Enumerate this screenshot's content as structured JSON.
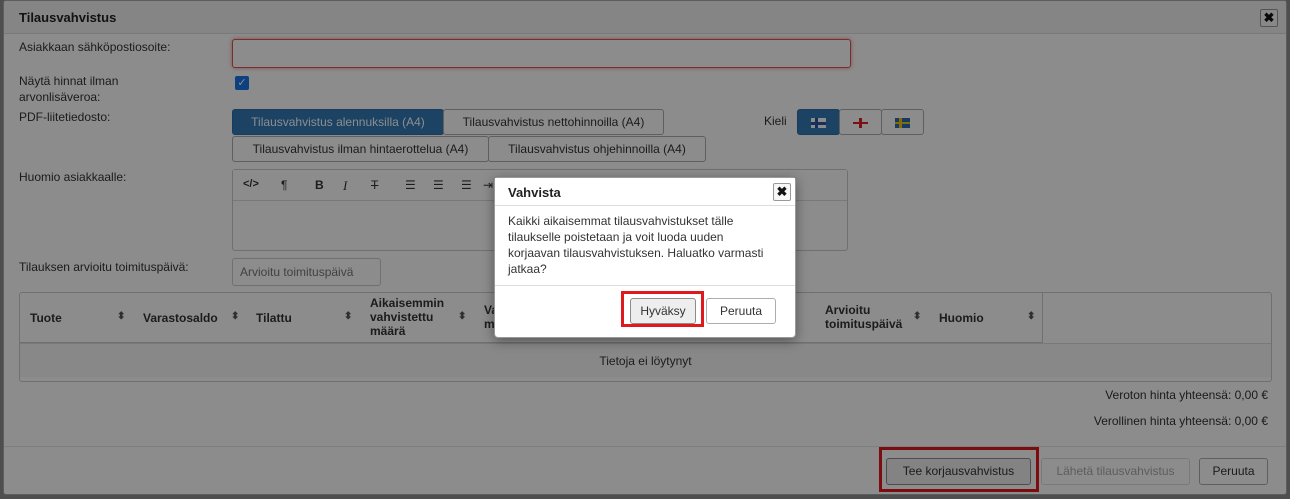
{
  "dialog": {
    "title": "Tilausvahvistus",
    "close_glyph": "✖"
  },
  "form": {
    "email_label": "Asiakkaan sähköpostiosoite:",
    "email_value": "",
    "show_prices_label_1": "Näytä hinnat ilman",
    "show_prices_label_2": "arvonlisäveroa:",
    "show_prices_checked": true,
    "pdf_label": "PDF-liitetiedosto:",
    "pdf_options": [
      "Tilausvahvistus alennuksilla (A4)",
      "Tilausvahvistus nettohinnoilla (A4)",
      "Tilausvahvistus ilman hintaerottelua (A4)",
      "Tilausvahvistus ohjehinnoilla (A4)"
    ],
    "pdf_selected": "Tilausvahvistus alennuksilla (A4)",
    "language_label": "Kieli",
    "languages": [
      "flag-fi-icon",
      "flag-en-icon",
      "flag-sv-icon"
    ],
    "language_selected": "flag-fi-icon",
    "note_label": "Huomio asiakkaalle:",
    "editor_tools": [
      "</>",
      "¶",
      "B",
      "I",
      "T"
    ],
    "delivery_label": "Tilauksen arvioitu toimituspäivä:",
    "delivery_placeholder": "Arvioitu toimituspäivä"
  },
  "table": {
    "columns": [
      {
        "l1": "Tuote",
        "l2": "",
        "l3": ""
      },
      {
        "l1": "Varastosaldo",
        "l2": "",
        "l3": ""
      },
      {
        "l1": "Tilattu",
        "l2": "",
        "l3": ""
      },
      {
        "l1": "Aikaisemmin",
        "l2": "vahvistettu",
        "l3": "määrä"
      },
      {
        "l1": "Va",
        "l2": "m",
        "l3": ""
      },
      {
        "l1": "Arvioitu",
        "l2": "toimituspäivä",
        "l3": ""
      },
      {
        "l1": "Huomio",
        "l2": "",
        "l3": ""
      }
    ],
    "sort_glyph": "⬍",
    "empty_text": "Tietoja ei löytynyt"
  },
  "totals": {
    "net": "Veroton hinta yhteensä: 0,00 €",
    "gross": "Verollinen hinta yhteensä: 0,00 €"
  },
  "footer": {
    "correction_button": "Tee korjausvahvistus",
    "send_button": "Lähetä tilausvahvistus",
    "cancel_button": "Peruuta"
  },
  "confirm": {
    "title": "Vahvista",
    "close_glyph": "✖",
    "message_lines": [
      "Kaikki aikaisemmat tilausvahvistukset tälle",
      "tilaukselle poistetaan ja voit luoda uuden",
      "korjaavan tilausvahvistuksen. Haluatko varmasti",
      "jatkaa?"
    ],
    "accept_button": "Hyväksy",
    "cancel_button": "Peruuta"
  },
  "colors": {
    "primary": "#337ab7",
    "highlight_red": "#e0191f",
    "checkbox": "#1a73e8"
  }
}
